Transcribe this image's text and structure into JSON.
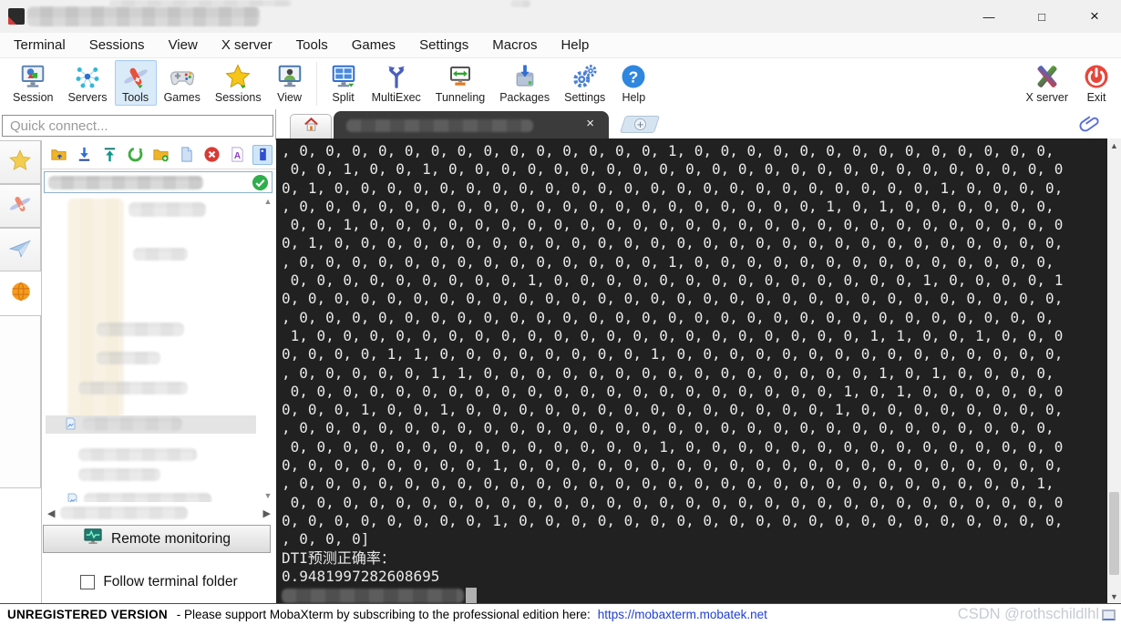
{
  "window": {
    "controls": {
      "minimize": "—",
      "maximize": "□",
      "close": "×"
    }
  },
  "menu": {
    "items": [
      "Terminal",
      "Sessions",
      "View",
      "X server",
      "Tools",
      "Games",
      "Settings",
      "Macros",
      "Help"
    ]
  },
  "toolbar": {
    "items": [
      {
        "label": "Session",
        "icon": "session-icon"
      },
      {
        "label": "Servers",
        "icon": "servers-icon"
      },
      {
        "label": "Tools",
        "icon": "tools-icon",
        "selected": true
      },
      {
        "label": "Games",
        "icon": "games-icon"
      },
      {
        "label": "Sessions",
        "icon": "sessions-star-icon"
      },
      {
        "label": "View",
        "icon": "view-icon"
      },
      {
        "label": "Split",
        "icon": "split-icon"
      },
      {
        "label": "MultiExec",
        "icon": "multiexec-icon"
      },
      {
        "label": "Tunneling",
        "icon": "tunneling-icon"
      },
      {
        "label": "Packages",
        "icon": "packages-icon"
      },
      {
        "label": "Settings",
        "icon": "settings-gears-icon"
      },
      {
        "label": "Help",
        "icon": "help-icon"
      },
      {
        "label": "X server",
        "icon": "xserver-icon"
      },
      {
        "label": "Exit",
        "icon": "exit-icon"
      }
    ]
  },
  "sidebar": {
    "quick_connect_placeholder": "Quick connect...",
    "remote_monitoring_label": "Remote monitoring",
    "follow_terminal_folder_label": "Follow terminal folder",
    "follow_checked": false
  },
  "tabbar": {
    "close_glyph": "×",
    "new_tab_glyph": "+"
  },
  "terminal": {
    "lines": [
      ", 0, 0, 0, 0, 0, 0, 0, 0, 0, 0, 0, 0, 0, 0, 1, 0, 0, 0, 0, 0, 0, 0, 0, 0, 0, 0, 0, 0, 0,",
      " 0, 0, 1, 0, 0, 1, 0, 0, 0, 0, 0, 0, 0, 0, 0, 0, 0, 0, 0, 0, 0, 0, 0, 0, 0, 0, 0, 0, 0, 0",
      "0, 1, 0, 0, 0, 0, 0, 0, 0, 0, 0, 0, 0, 0, 0, 0, 0, 0, 0, 0, 0, 0, 0, 0, 0, 1, 0, 0, 0, 0,",
      ", 0, 0, 0, 0, 0, 0, 0, 0, 0, 0, 0, 0, 0, 0, 0, 0, 0, 0, 0, 0, 1, 0, 1, 0, 0, 0, 0, 0, 0,",
      " 0, 0, 1, 0, 0, 0, 0, 0, 0, 0, 0, 0, 0, 0, 0, 0, 0, 0, 0, 0, 0, 0, 0, 0, 0, 0, 0, 0, 0, 0",
      "0, 1, 0, 0, 0, 0, 0, 0, 0, 0, 0, 0, 0, 0, 0, 0, 0, 0, 0, 0, 0, 0, 0, 0, 0, 0, 0, 0, 0, 0,",
      ", 0, 0, 0, 0, 0, 0, 0, 0, 0, 0, 0, 0, 0, 0, 1, 0, 0, 0, 0, 0, 0, 0, 0, 0, 0, 0, 0, 0, 0,",
      " 0, 0, 0, 0, 0, 0, 0, 0, 0, 1, 0, 0, 0, 0, 0, 0, 0, 0, 0, 0, 0, 0, 0, 0, 1, 0, 0, 0, 0, 1",
      "0, 0, 0, 0, 0, 0, 0, 0, 0, 0, 0, 0, 0, 0, 0, 0, 0, 0, 0, 0, 0, 0, 0, 0, 0, 0, 0, 0, 0, 0,",
      ", 0, 0, 0, 0, 0, 0, 0, 0, 0, 0, 0, 0, 0, 0, 0, 0, 0, 0, 0, 0, 0, 0, 0, 0, 0, 0, 0, 0, 0,",
      " 1, 0, 0, 0, 0, 0, 0, 0, 0, 0, 0, 0, 0, 0, 0, 0, 0, 0, 0, 0, 0, 0, 1, 1, 0, 0, 1, 0, 0, 0",
      "0, 0, 0, 0, 1, 1, 0, 0, 0, 0, 0, 0, 0, 0, 1, 0, 0, 0, 0, 0, 0, 0, 0, 0, 0, 0, 0, 0, 0, 0,",
      ", 0, 0, 0, 0, 0, 1, 1, 0, 0, 0, 0, 0, 0, 0, 0, 0, 0, 0, 0, 0, 0, 0, 1, 0, 1, 0, 0, 0, 0,",
      " 0, 0, 0, 0, 0, 0, 0, 0, 0, 0, 0, 0, 0, 0, 0, 0, 0, 0, 0, 0, 0, 1, 0, 1, 0, 0, 0, 0, 0, 0",
      "0, 0, 0, 1, 0, 0, 1, 0, 0, 0, 0, 0, 0, 0, 0, 0, 0, 0, 0, 0, 0, 1, 0, 0, 0, 0, 0, 0, 0, 0,",
      ", 0, 0, 0, 0, 0, 0, 0, 0, 0, 0, 0, 0, 0, 0, 0, 0, 0, 0, 0, 0, 0, 0, 0, 0, 0, 0, 0, 0, 0,",
      " 0, 0, 0, 0, 0, 0, 0, 0, 0, 0, 0, 0, 0, 0, 1, 0, 0, 0, 0, 0, 0, 0, 0, 0, 0, 0, 0, 0, 0, 0",
      "0, 0, 0, 0, 0, 0, 0, 0, 1, 0, 0, 0, 0, 0, 0, 0, 0, 0, 0, 0, 0, 0, 0, 0, 0, 0, 0, 0, 0, 0,",
      ", 0, 0, 0, 0, 0, 0, 0, 0, 0, 0, 0, 0, 0, 0, 0, 0, 0, 0, 0, 0, 0, 0, 0, 0, 0, 0, 0, 0, 1,",
      " 0, 0, 0, 0, 0, 0, 0, 0, 0, 0, 0, 0, 0, 0, 0, 0, 0, 0, 0, 0, 0, 0, 0, 0, 0, 0, 0, 0, 0, 0",
      "0, 0, 0, 0, 0, 0, 0, 0, 1, 0, 0, 0, 0, 0, 0, 0, 0, 0, 0, 0, 0, 0, 0, 0, 0, 0, 0, 0, 0, 0,",
      ", 0, 0, 0]",
      "DTI预测正确率：",
      "0.9481997282608695"
    ]
  },
  "statusbar": {
    "version": "UNREGISTERED VERSION",
    "message": "-  Please support MobaXterm by subscribing to the professional edition here:",
    "link": "https://mobaxterm.mobatek.net",
    "watermark": "CSDN @rothschildlhl"
  },
  "colors": {
    "terminal_background": "#212121",
    "terminal_text": "#e8e8e8",
    "toolbar_selected": "#d9eaf9",
    "link_blue": "#1f3fd4",
    "active_tab": "#3b3b3b"
  }
}
